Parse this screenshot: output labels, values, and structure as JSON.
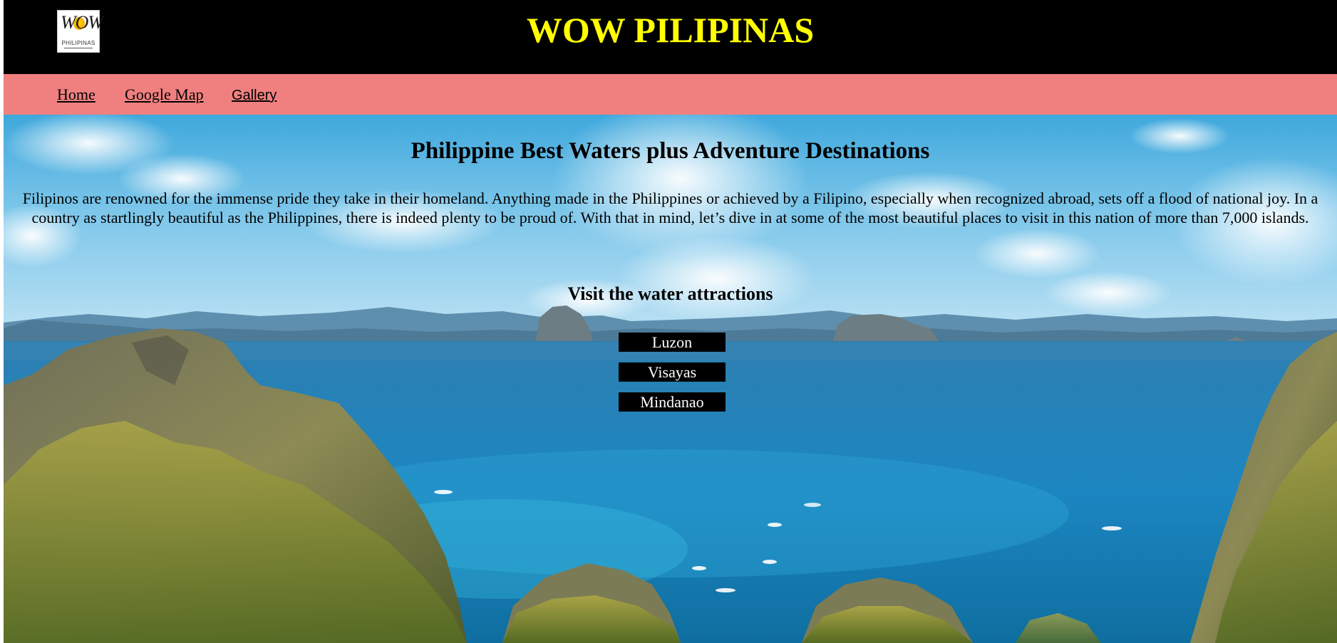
{
  "header": {
    "logo": {
      "mark_text": "WOW",
      "caption": "PHILIPINAS"
    },
    "title": "WOW PILIPINAS",
    "title_color": "#ffff00",
    "background": "#000000"
  },
  "nav": {
    "background": "#f08080",
    "items": [
      {
        "label": "Home"
      },
      {
        "label": "Google Map"
      },
      {
        "label": "Gallery"
      }
    ]
  },
  "main": {
    "heading": "Philippine Best Waters plus Adventure Destinations",
    "intro": "Filipinos are renowned for the immense pride they take in their homeland. Anything made in the Philippines or achieved by a Filipino, especially when recognized abroad, sets off a flood of national joy. In a country as startlingly beautiful as the Philippines, there is indeed plenty to be proud of. With that in mind, let’s dive in at some of the most beautiful places to visit in this nation of more than 7,000 islands.",
    "subheading": "Visit the water attractions",
    "buttons": [
      {
        "label": "Luzon"
      },
      {
        "label": "Visayas"
      },
      {
        "label": "Mindanao"
      }
    ]
  }
}
